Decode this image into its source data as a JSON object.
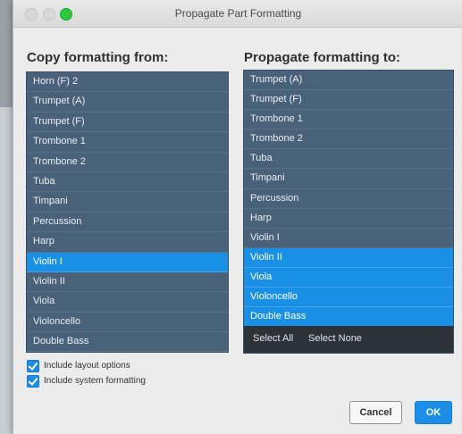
{
  "window": {
    "title": "Propagate Part Formatting"
  },
  "copy_from": {
    "heading": "Copy formatting from:",
    "items": [
      {
        "label": "Horn (F) 2",
        "selected": false
      },
      {
        "label": "Trumpet (A)",
        "selected": false
      },
      {
        "label": "Trumpet (F)",
        "selected": false
      },
      {
        "label": "Trombone 1",
        "selected": false
      },
      {
        "label": "Trombone 2",
        "selected": false
      },
      {
        "label": "Tuba",
        "selected": false
      },
      {
        "label": "Timpani",
        "selected": false
      },
      {
        "label": "Percussion",
        "selected": false
      },
      {
        "label": "Harp",
        "selected": false
      },
      {
        "label": "Violin I",
        "selected": true
      },
      {
        "label": "Violin II",
        "selected": false
      },
      {
        "label": "Viola",
        "selected": false
      },
      {
        "label": "Violoncello",
        "selected": false
      },
      {
        "label": "Double Bass",
        "selected": false
      }
    ]
  },
  "propagate_to": {
    "heading": "Propagate formatting to:",
    "items": [
      {
        "label": "Trumpet (A)",
        "selected": false
      },
      {
        "label": "Trumpet (F)",
        "selected": false
      },
      {
        "label": "Trombone 1",
        "selected": false
      },
      {
        "label": "Trombone 2",
        "selected": false
      },
      {
        "label": "Tuba",
        "selected": false
      },
      {
        "label": "Timpani",
        "selected": false
      },
      {
        "label": "Percussion",
        "selected": false
      },
      {
        "label": "Harp",
        "selected": false
      },
      {
        "label": "Violin I",
        "selected": false
      },
      {
        "label": "Violin II",
        "selected": true
      },
      {
        "label": "Viola",
        "selected": true
      },
      {
        "label": "Violoncello",
        "selected": true
      },
      {
        "label": "Double Bass",
        "selected": true
      }
    ],
    "select_all": "Select All",
    "select_none": "Select None"
  },
  "options": {
    "include_layout": {
      "label": "Include layout options",
      "checked": true
    },
    "include_system": {
      "label": "Include system formatting",
      "checked": true
    }
  },
  "buttons": {
    "cancel": "Cancel",
    "ok": "OK"
  },
  "colors": {
    "list_bg": "#4a6279",
    "selected": "#1a8fe6",
    "accent": "#1c8ee8"
  }
}
